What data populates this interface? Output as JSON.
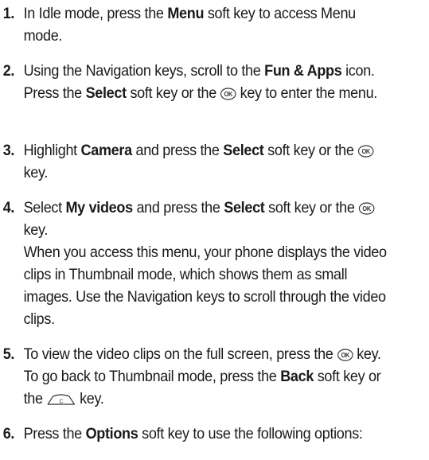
{
  "steps": [
    {
      "number": "1.",
      "parts": [
        {
          "t": "text",
          "v": "In Idle mode, press the "
        },
        {
          "t": "bold",
          "v": "Menu"
        },
        {
          "t": "text",
          "v": " soft key to access Menu mode."
        }
      ]
    },
    {
      "number": "2.",
      "parts": [
        {
          "t": "text",
          "v": "Using the Navigation keys, scroll to the "
        },
        {
          "t": "bold",
          "v": "Fun & Apps"
        },
        {
          "t": "text",
          "v": " icon. Press the "
        },
        {
          "t": "bold",
          "v": "Select"
        },
        {
          "t": "text",
          "v": " soft key or the "
        },
        {
          "t": "icon",
          "v": "ok-key-icon"
        },
        {
          "t": "text",
          "v": " key to enter the menu."
        }
      ]
    },
    {
      "number": "3.",
      "parts": [
        {
          "t": "text",
          "v": "Highlight "
        },
        {
          "t": "bold",
          "v": "Camera"
        },
        {
          "t": "text",
          "v": " and press the "
        },
        {
          "t": "bold",
          "v": "Select"
        },
        {
          "t": "text",
          "v": " soft key or the "
        },
        {
          "t": "icon",
          "v": "ok-key-icon"
        },
        {
          "t": "text",
          "v": " key."
        }
      ]
    },
    {
      "number": "4.",
      "parts": [
        {
          "t": "text",
          "v": "Select "
        },
        {
          "t": "bold",
          "v": "My videos"
        },
        {
          "t": "text",
          "v": " and press the "
        },
        {
          "t": "bold",
          "v": "Select"
        },
        {
          "t": "text",
          "v": " soft key or the "
        },
        {
          "t": "icon",
          "v": "ok-key-icon"
        },
        {
          "t": "text",
          "v": " key."
        },
        {
          "t": "break"
        },
        {
          "t": "text",
          "v": "When you access this menu, your phone displays the video clips in Thumbnail mode, which shows them as small images. Use the Navigation keys to scroll through the video clips."
        }
      ]
    },
    {
      "number": "5.",
      "parts": [
        {
          "t": "text",
          "v": "To view the video clips on the full screen, press the "
        },
        {
          "t": "icon",
          "v": "ok-key-icon"
        },
        {
          "t": "text",
          "v": " key. To go back to Thumbnail mode, press the "
        },
        {
          "t": "bold",
          "v": "Back"
        },
        {
          "t": "text",
          "v": " soft key or the "
        },
        {
          "t": "icon",
          "v": "clear-key-icon"
        },
        {
          "t": "text",
          "v": " key."
        }
      ]
    },
    {
      "number": "6.",
      "parts": [
        {
          "t": "text",
          "v": "Press the "
        },
        {
          "t": "bold",
          "v": "Options"
        },
        {
          "t": "text",
          "v": " soft key to use the following options:"
        }
      ]
    }
  ],
  "icons": {
    "ok_key_label": "OK",
    "clear_key_label": "C"
  },
  "colors": {
    "text": "#1a1a1a",
    "icon_stroke": "#333333"
  }
}
